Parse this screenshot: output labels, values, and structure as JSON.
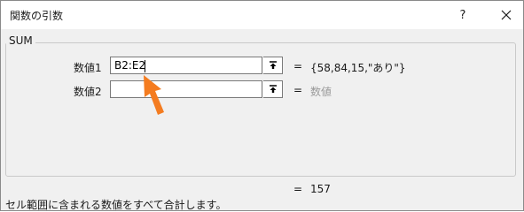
{
  "window": {
    "title": "関数の引数",
    "help_label": "?"
  },
  "function": {
    "name": "SUM",
    "args": [
      {
        "label": "数値1",
        "input_value": "B2:E2",
        "eq": "=",
        "result": "{58,84,15,\"あり\"}"
      },
      {
        "label": "数値2",
        "input_value": "",
        "eq": "=",
        "result": "数値"
      }
    ],
    "total_eq": "=",
    "total_result": "157",
    "description": "セル範囲に含まれる数値をすべて合計します。"
  },
  "icons": {
    "close": "close-icon",
    "ref": "collapse-dialog-icon",
    "arrow": "pointer-arrow-icon"
  },
  "colors": {
    "arrow": "#f47c20",
    "placeholder": "#9a9a9a"
  }
}
